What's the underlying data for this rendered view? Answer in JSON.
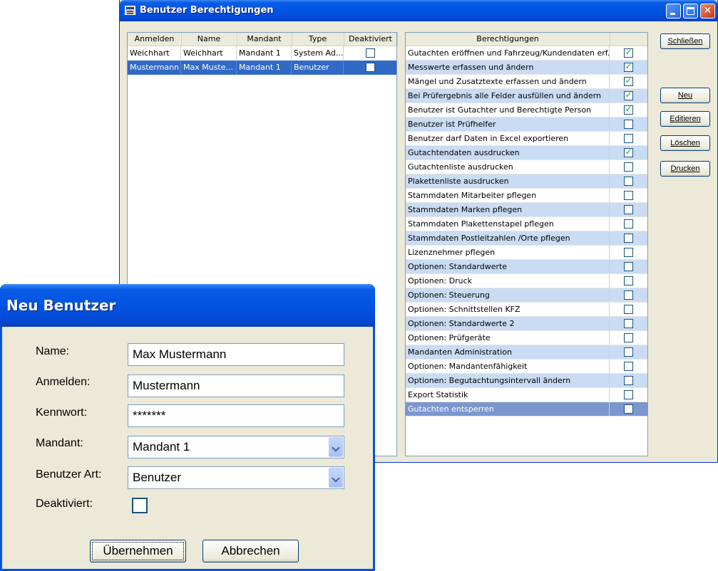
{
  "main_window": {
    "title": "Benutzer Berechtigungen",
    "close_glyph": "✕",
    "user_columns": [
      "Anmelden",
      "Name",
      "Mandant",
      "Type",
      "Deaktiviert"
    ],
    "users": [
      {
        "anmelden": "Weichhart",
        "name": "Weichhart",
        "mandant": "Mandant 1",
        "type": "System Ad...",
        "deaktiviert": false
      },
      {
        "anmelden": "Mustermann",
        "name": "Max Muste...",
        "mandant": "Mandant 1",
        "type": "Benutzer",
        "deaktiviert": false
      }
    ],
    "perm_column": "Berechtigungen",
    "permissions": [
      {
        "label": "Gutachten eröffnen und Fahrzeug/Kundendaten erf...",
        "checked": true
      },
      {
        "label": "Messwerte erfassen und ändern",
        "checked": true
      },
      {
        "label": "Mängel und Zusatztexte erfassen und ändern",
        "checked": true
      },
      {
        "label": "Bei Prüfergebnis alle Felder ausfüllen und ändern",
        "checked": true
      },
      {
        "label": "Benutzer ist  Gutachter und Berechtigte Person",
        "checked": true
      },
      {
        "label": "Benutzer ist Prüfhelfer",
        "checked": false
      },
      {
        "label": "Benutzer darf Daten in Excel exportieren",
        "checked": false
      },
      {
        "label": "Gutachtendaten ausdrucken",
        "checked": true
      },
      {
        "label": "Gutachtenliste ausdrucken",
        "checked": false
      },
      {
        "label": "Plakettenliste ausdrucken",
        "checked": false
      },
      {
        "label": "Stammdaten Mitarbeiter pflegen",
        "checked": false
      },
      {
        "label": "Stammdaten Marken pflegen",
        "checked": false
      },
      {
        "label": "Stammdaten Plakettenstapel pflegen",
        "checked": false
      },
      {
        "label": "Stammdaten Postleitzahlen /Orte pflegen",
        "checked": false
      },
      {
        "label": "Lizenznehmer pflegen",
        "checked": false
      },
      {
        "label": "Optionen: Standardwerte",
        "checked": false
      },
      {
        "label": "Optionen: Druck",
        "checked": false
      },
      {
        "label": "Optionen: Steuerung",
        "checked": false
      },
      {
        "label": "Optionen: Schnittstellen KFZ",
        "checked": false
      },
      {
        "label": "Optionen: Standardwerte 2",
        "checked": false
      },
      {
        "label": "Optionen: Prüfgeräte",
        "checked": false
      },
      {
        "label": "Mandanten Administration",
        "checked": false
      },
      {
        "label": "Optionen: Mandantenfähigkeit",
        "checked": false
      },
      {
        "label": "Optionen: Begutachtungsintervall ändern",
        "checked": false
      },
      {
        "label": "Export Statistik",
        "checked": false
      },
      {
        "label": "Gutachten entsperren",
        "checked": false
      }
    ],
    "buttons": {
      "schliessen": "Schließen",
      "neu": "Neu",
      "editieren": "Editieren",
      "loeschen": "Löschen",
      "drucken": "Drucken"
    }
  },
  "dialog": {
    "title": "Neu Benutzer",
    "name_label": "Name:",
    "name_value": "Max Mustermann",
    "anmelden_label": "Anmelden:",
    "anmelden_value": "Mustermann",
    "kennwort_label": "Kennwort:",
    "kennwort_value": "*******",
    "mandant_label": "Mandant:",
    "mandant_value": "Mandant 1",
    "art_label": "Benutzer Art:",
    "art_value": "Benutzer",
    "deaktiviert_label": "Deaktiviert:",
    "deaktiviert": false,
    "ok_label": "Übernehmen",
    "cancel_label": "Abbrechen"
  }
}
